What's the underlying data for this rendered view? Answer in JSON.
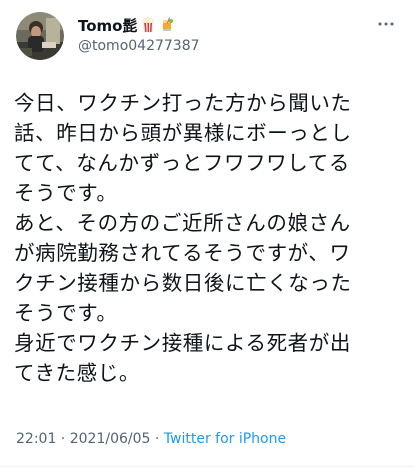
{
  "user": {
    "display_name": "Tomo髭",
    "handle": "@tomo04277387",
    "emoji_1": "popcorn-icon",
    "emoji_2": "cocktail-icon"
  },
  "tweet": {
    "lines": [
      "今日、ワクチン打った方から聞いた",
      "話、昨日から頭が異様にボーっとし",
      "てて、なんかずっとフワフワしてる",
      "そうです。",
      "あと、その方のご近所さんの娘さん",
      "が病院勤務されてるそうですが、ワ",
      "クチン接種から数日後に亡くなった",
      "そうです。",
      "身近でワクチン接種による死者が出",
      "てきた感じ。"
    ]
  },
  "meta": {
    "time": "22:01",
    "separator_1": " · ",
    "date": "2021/06/05",
    "separator_2": " · ",
    "source": "Twitter for iPhone"
  },
  "colors": {
    "text": "#0f1419",
    "secondary": "#536471",
    "accent": "#1d9bf0"
  }
}
